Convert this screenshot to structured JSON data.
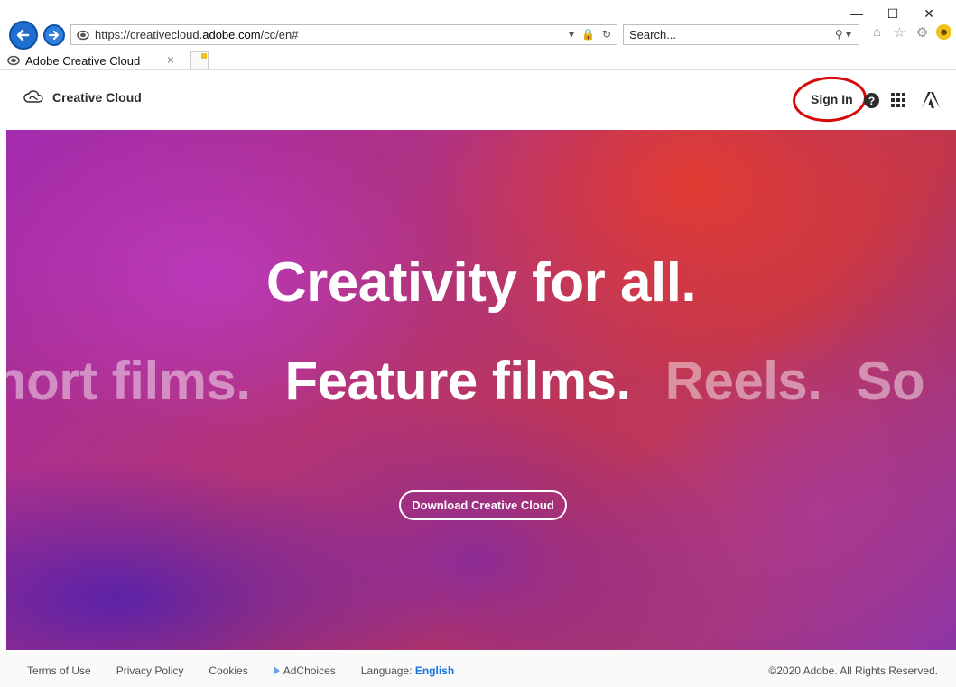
{
  "browser": {
    "url_prefix": "https://creativecloud.",
    "url_host": "adobe.com",
    "url_path": "/cc/en#",
    "search_placeholder": "Search...",
    "tab_title": "Adobe Creative Cloud"
  },
  "header": {
    "brand": "Creative Cloud",
    "sign_in": "Sign In",
    "help": "?"
  },
  "hero": {
    "title": "Creativity for all.",
    "rotator": [
      "hort films.",
      "Feature films.",
      "Reels.",
      "So"
    ],
    "cta": "Download Creative Cloud"
  },
  "footer": {
    "links": [
      "Terms of Use",
      "Privacy Policy",
      "Cookies",
      "AdChoices"
    ],
    "language_label": "Language:",
    "language_value": "English",
    "copyright": "©2020 Adobe. All Rights Reserved."
  },
  "colors": {
    "annotation_ring": "#d40a0a",
    "link_blue": "#1473e6"
  }
}
